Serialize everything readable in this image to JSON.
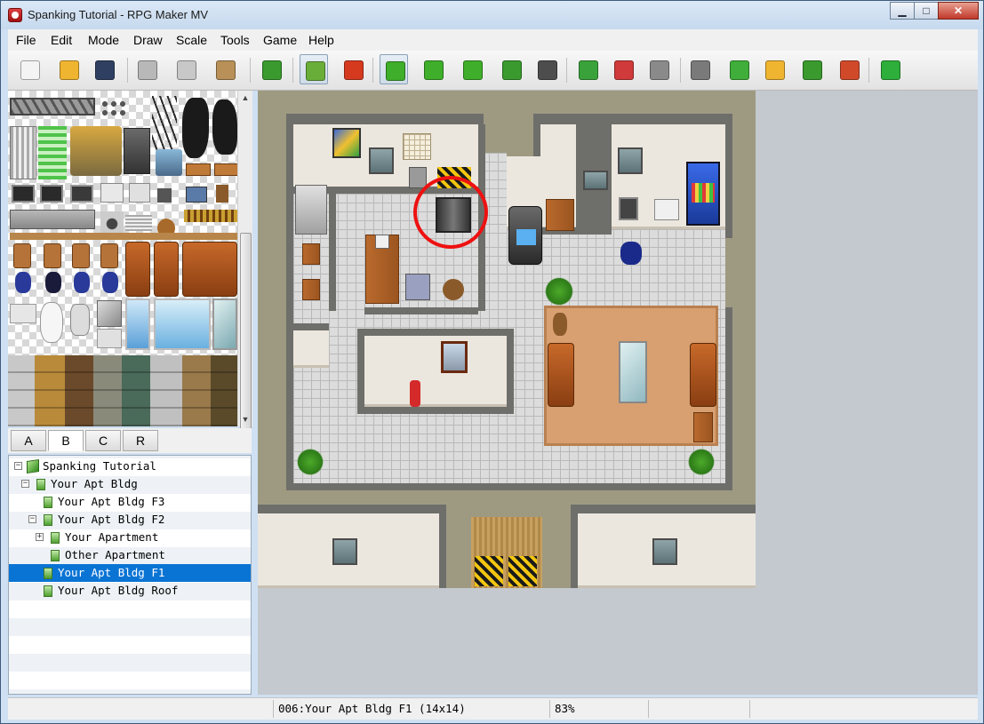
{
  "window": {
    "title": "Spanking Tutorial - RPG Maker MV",
    "minimize": "▁",
    "maximize": "□",
    "close": "✕"
  },
  "menu": [
    "File",
    "Edit",
    "Mode",
    "Draw",
    "Scale",
    "Tools",
    "Game",
    "Help"
  ],
  "toolbar": {
    "buttons": [
      {
        "icon": "new-project-icon",
        "color": "#f4f4f4"
      },
      {
        "icon": "open-project-icon",
        "color": "#f0b530"
      },
      {
        "icon": "save-project-icon",
        "color": "#2e3f62"
      },
      {
        "icon": "cut-icon",
        "color": "#b8b8b8"
      },
      {
        "icon": "copy-icon",
        "color": "#c8c8c8"
      },
      {
        "icon": "paste-icon",
        "color": "#b89058"
      },
      {
        "icon": "undo-icon",
        "color": "#3a9a2e"
      },
      {
        "icon": "map-mode-icon",
        "color": "#6aae3a",
        "active": true
      },
      {
        "icon": "event-mode-icon",
        "color": "#d53a1f"
      },
      {
        "icon": "pencil-icon",
        "color": "#3fae2a",
        "active": true
      },
      {
        "icon": "rectangle-icon",
        "color": "#3fae2a"
      },
      {
        "icon": "ellipse-icon",
        "color": "#3fae2a"
      },
      {
        "icon": "flood-fill-icon",
        "color": "#3a9a2e"
      },
      {
        "icon": "shadow-pen-icon",
        "color": "#4d4d4d"
      },
      {
        "icon": "zoom-in-icon",
        "color": "#3aa23a"
      },
      {
        "icon": "zoom-out-icon",
        "color": "#d03a3a"
      },
      {
        "icon": "actual-size-icon",
        "color": "#8a8a8a"
      },
      {
        "icon": "database-icon",
        "color": "#7a7a7a"
      },
      {
        "icon": "plugin-manager-icon",
        "color": "#3fae3a"
      },
      {
        "icon": "sound-test-icon",
        "color": "#f0b530"
      },
      {
        "icon": "event-searcher-icon",
        "color": "#3a9a2e"
      },
      {
        "icon": "character-generator-icon",
        "color": "#d04a2a"
      },
      {
        "icon": "playtest-icon",
        "color": "#2eae3a"
      }
    ]
  },
  "tileset_tabs": [
    {
      "label": "A",
      "selected": false
    },
    {
      "label": "B",
      "selected": true
    },
    {
      "label": "C",
      "selected": false
    },
    {
      "label": "R",
      "selected": false
    }
  ],
  "map_tree": [
    {
      "label": "Spanking Tutorial",
      "level": 0,
      "expander": "−",
      "type": "project"
    },
    {
      "label": "Your Apt Bldg",
      "level": 1,
      "expander": "−",
      "type": "map"
    },
    {
      "label": "Your Apt Bldg F3",
      "level": 2,
      "expander": "",
      "type": "map"
    },
    {
      "label": "Your Apt Bldg F2",
      "level": 2,
      "expander": "−",
      "type": "map"
    },
    {
      "label": "Your Apartment",
      "level": 3,
      "expander": "+",
      "type": "map"
    },
    {
      "label": "Other Apartment",
      "level": 3,
      "expander": "",
      "type": "map"
    },
    {
      "label": "Your Apt Bldg F1",
      "level": 2,
      "expander": "",
      "type": "map",
      "selected": true
    },
    {
      "label": "Your Apt Bldg Roof",
      "level": 2,
      "expander": "",
      "type": "map"
    }
  ],
  "status": {
    "left": "",
    "map_info": "006:Your Apt Bldg F1 (14x14)",
    "zoom": "83%",
    "coords": ""
  }
}
